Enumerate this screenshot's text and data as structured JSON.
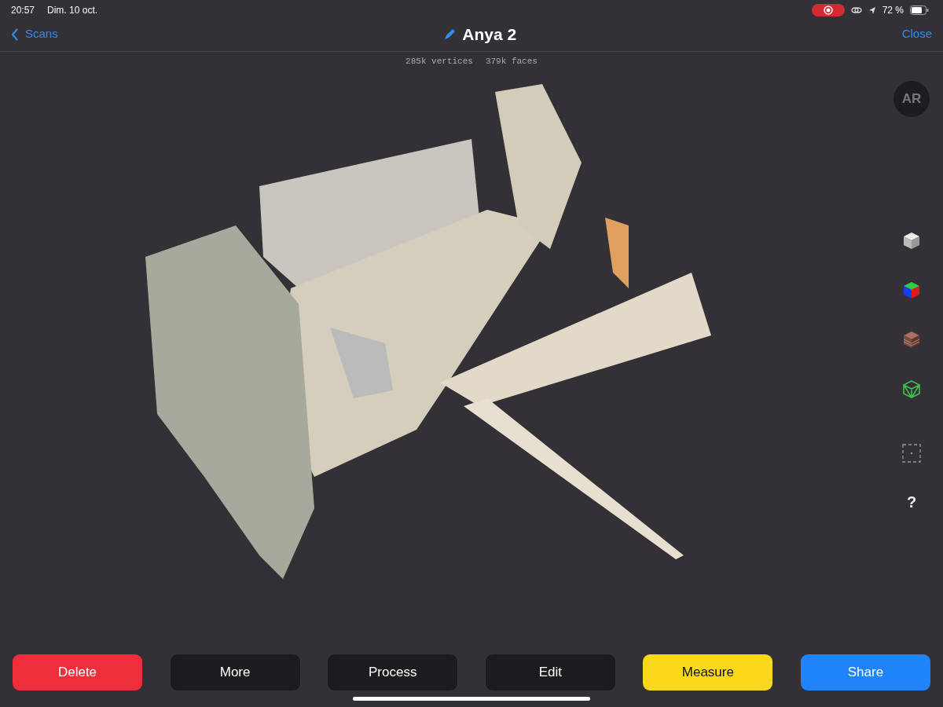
{
  "status_bar": {
    "time": "20:57",
    "date": "Dim. 10 oct.",
    "battery": "72 %"
  },
  "nav": {
    "back": "Scans",
    "title": "Anya 2",
    "close": "Close"
  },
  "stats": [
    "285k vertices",
    "379k faces"
  ],
  "side": {
    "ar": "AR",
    "help": "?"
  },
  "buttons": [
    {
      "label": "Delete",
      "kind": "danger"
    },
    {
      "label": "More",
      "kind": "neutral"
    },
    {
      "label": "Process",
      "kind": "neutral"
    },
    {
      "label": "Edit",
      "kind": "neutral"
    },
    {
      "label": "Measure",
      "kind": "warning"
    },
    {
      "label": "Share",
      "kind": "primary"
    }
  ]
}
